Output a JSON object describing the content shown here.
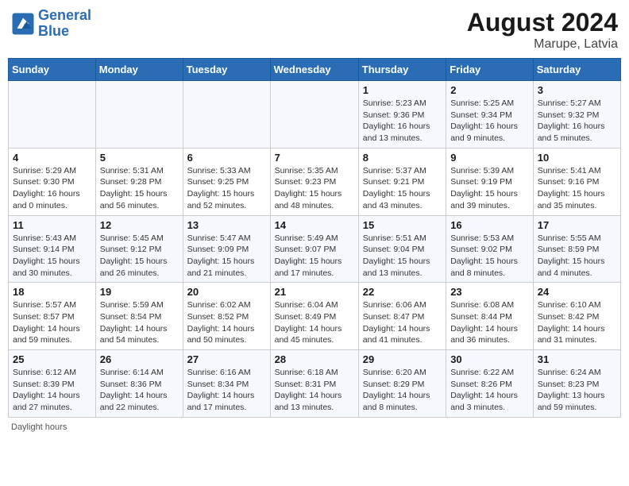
{
  "header": {
    "logo_line1": "General",
    "logo_line2": "Blue",
    "month_year": "August 2024",
    "location": "Marupe, Latvia"
  },
  "days_of_week": [
    "Sunday",
    "Monday",
    "Tuesday",
    "Wednesday",
    "Thursday",
    "Friday",
    "Saturday"
  ],
  "weeks": [
    [
      {
        "day": "",
        "info": ""
      },
      {
        "day": "",
        "info": ""
      },
      {
        "day": "",
        "info": ""
      },
      {
        "day": "",
        "info": ""
      },
      {
        "day": "1",
        "info": "Sunrise: 5:23 AM\nSunset: 9:36 PM\nDaylight: 16 hours\nand 13 minutes."
      },
      {
        "day": "2",
        "info": "Sunrise: 5:25 AM\nSunset: 9:34 PM\nDaylight: 16 hours\nand 9 minutes."
      },
      {
        "day": "3",
        "info": "Sunrise: 5:27 AM\nSunset: 9:32 PM\nDaylight: 16 hours\nand 5 minutes."
      }
    ],
    [
      {
        "day": "4",
        "info": "Sunrise: 5:29 AM\nSunset: 9:30 PM\nDaylight: 16 hours\nand 0 minutes."
      },
      {
        "day": "5",
        "info": "Sunrise: 5:31 AM\nSunset: 9:28 PM\nDaylight: 15 hours\nand 56 minutes."
      },
      {
        "day": "6",
        "info": "Sunrise: 5:33 AM\nSunset: 9:25 PM\nDaylight: 15 hours\nand 52 minutes."
      },
      {
        "day": "7",
        "info": "Sunrise: 5:35 AM\nSunset: 9:23 PM\nDaylight: 15 hours\nand 48 minutes."
      },
      {
        "day": "8",
        "info": "Sunrise: 5:37 AM\nSunset: 9:21 PM\nDaylight: 15 hours\nand 43 minutes."
      },
      {
        "day": "9",
        "info": "Sunrise: 5:39 AM\nSunset: 9:19 PM\nDaylight: 15 hours\nand 39 minutes."
      },
      {
        "day": "10",
        "info": "Sunrise: 5:41 AM\nSunset: 9:16 PM\nDaylight: 15 hours\nand 35 minutes."
      }
    ],
    [
      {
        "day": "11",
        "info": "Sunrise: 5:43 AM\nSunset: 9:14 PM\nDaylight: 15 hours\nand 30 minutes."
      },
      {
        "day": "12",
        "info": "Sunrise: 5:45 AM\nSunset: 9:12 PM\nDaylight: 15 hours\nand 26 minutes."
      },
      {
        "day": "13",
        "info": "Sunrise: 5:47 AM\nSunset: 9:09 PM\nDaylight: 15 hours\nand 21 minutes."
      },
      {
        "day": "14",
        "info": "Sunrise: 5:49 AM\nSunset: 9:07 PM\nDaylight: 15 hours\nand 17 minutes."
      },
      {
        "day": "15",
        "info": "Sunrise: 5:51 AM\nSunset: 9:04 PM\nDaylight: 15 hours\nand 13 minutes."
      },
      {
        "day": "16",
        "info": "Sunrise: 5:53 AM\nSunset: 9:02 PM\nDaylight: 15 hours\nand 8 minutes."
      },
      {
        "day": "17",
        "info": "Sunrise: 5:55 AM\nSunset: 8:59 PM\nDaylight: 15 hours\nand 4 minutes."
      }
    ],
    [
      {
        "day": "18",
        "info": "Sunrise: 5:57 AM\nSunset: 8:57 PM\nDaylight: 14 hours\nand 59 minutes."
      },
      {
        "day": "19",
        "info": "Sunrise: 5:59 AM\nSunset: 8:54 PM\nDaylight: 14 hours\nand 54 minutes."
      },
      {
        "day": "20",
        "info": "Sunrise: 6:02 AM\nSunset: 8:52 PM\nDaylight: 14 hours\nand 50 minutes."
      },
      {
        "day": "21",
        "info": "Sunrise: 6:04 AM\nSunset: 8:49 PM\nDaylight: 14 hours\nand 45 minutes."
      },
      {
        "day": "22",
        "info": "Sunrise: 6:06 AM\nSunset: 8:47 PM\nDaylight: 14 hours\nand 41 minutes."
      },
      {
        "day": "23",
        "info": "Sunrise: 6:08 AM\nSunset: 8:44 PM\nDaylight: 14 hours\nand 36 minutes."
      },
      {
        "day": "24",
        "info": "Sunrise: 6:10 AM\nSunset: 8:42 PM\nDaylight: 14 hours\nand 31 minutes."
      }
    ],
    [
      {
        "day": "25",
        "info": "Sunrise: 6:12 AM\nSunset: 8:39 PM\nDaylight: 14 hours\nand 27 minutes."
      },
      {
        "day": "26",
        "info": "Sunrise: 6:14 AM\nSunset: 8:36 PM\nDaylight: 14 hours\nand 22 minutes."
      },
      {
        "day": "27",
        "info": "Sunrise: 6:16 AM\nSunset: 8:34 PM\nDaylight: 14 hours\nand 17 minutes."
      },
      {
        "day": "28",
        "info": "Sunrise: 6:18 AM\nSunset: 8:31 PM\nDaylight: 14 hours\nand 13 minutes."
      },
      {
        "day": "29",
        "info": "Sunrise: 6:20 AM\nSunset: 8:29 PM\nDaylight: 14 hours\nand 8 minutes."
      },
      {
        "day": "30",
        "info": "Sunrise: 6:22 AM\nSunset: 8:26 PM\nDaylight: 14 hours\nand 3 minutes."
      },
      {
        "day": "31",
        "info": "Sunrise: 6:24 AM\nSunset: 8:23 PM\nDaylight: 13 hours\nand 59 minutes."
      }
    ]
  ],
  "footer": {
    "note": "Daylight hours"
  }
}
